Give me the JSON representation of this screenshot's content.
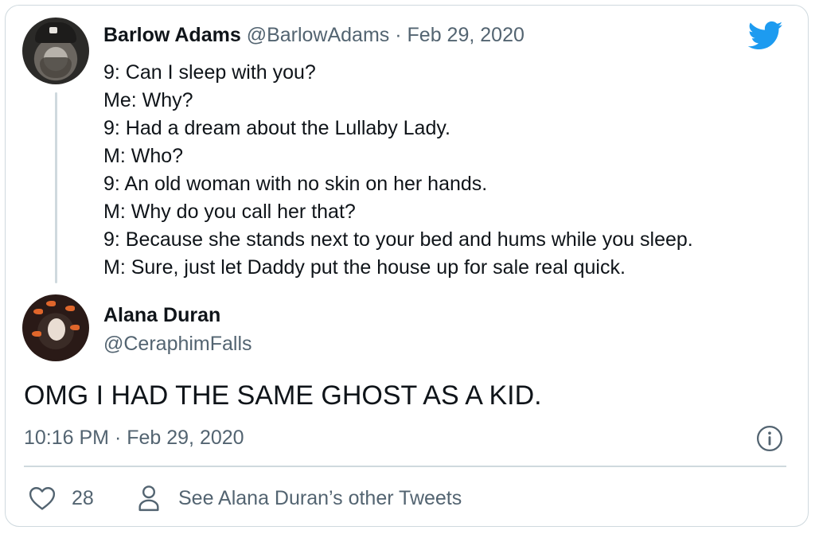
{
  "original_tweet": {
    "author_name": "Barlow Adams",
    "handle": "@BarlowAdams",
    "separator": "·",
    "date": "Feb 29, 2020",
    "lines": [
      "9: Can I sleep with you?",
      "Me: Why?",
      "9: Had a dream about the Lullaby Lady.",
      "M: Who?",
      "9: An old woman with no skin on her hands.",
      "M: Why do you call her that?",
      "9: Because she stands next to your bed and hums while you sleep.",
      "M: Sure, just let Daddy put the house up for sale real quick."
    ]
  },
  "reply_tweet": {
    "author_name": "Alana Duran",
    "handle": "@CeraphimFalls",
    "text": "OMG I HAD THE SAME GHOST AS A KID.",
    "timestamp": "10:16 PM · Feb 29, 2020"
  },
  "footer": {
    "like_count": "28",
    "see_more_label": "See Alana Duran’s other Tweets"
  },
  "icons": {
    "brand": "twitter-bird-icon",
    "info": "info-icon",
    "like": "heart-icon",
    "profile": "person-icon"
  },
  "colors": {
    "twitter_blue": "#1d9bf0",
    "muted_text": "#536471",
    "border": "#cfd9de",
    "text": "#0f1419"
  }
}
